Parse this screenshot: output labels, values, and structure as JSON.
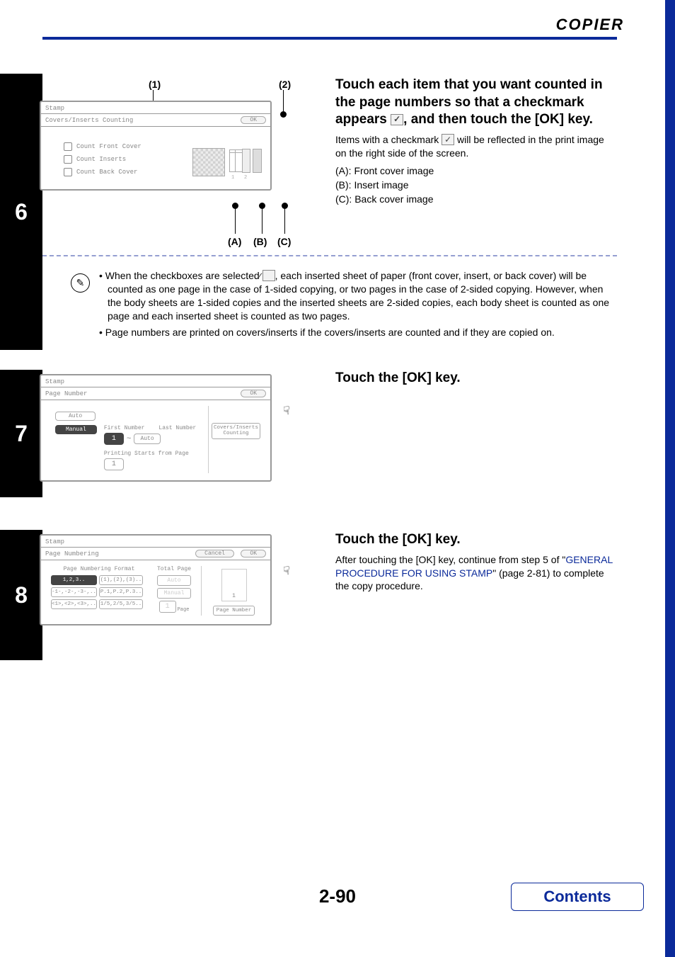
{
  "header": {
    "title": "COPIER"
  },
  "step6": {
    "num": "6",
    "heading_pre": "Touch each item that you want counted in the page numbers so that a checkmark appears ",
    "heading_post": ", and then touch the [OK] key.",
    "sub_pre": "Items with a checkmark ",
    "sub_post": " will be reflected in the print image on the right side of the screen.",
    "labels": {
      "a": "(A): Front cover image",
      "b": "(B): Insert image",
      "c": "(C): Back cover image"
    },
    "callouts": {
      "c1": "(1)",
      "c2": "(2)",
      "ca": "(A)",
      "cb": "(B)",
      "cc": "(C)"
    },
    "panel": {
      "tab": "Stamp",
      "title": "Covers/Inserts Counting",
      "ok": "OK",
      "opt_front": "Count Front Cover",
      "opt_inserts": "Count Inserts",
      "opt_back": "Count Back Cover"
    },
    "bullets": {
      "b1": "When the checkboxes are selected ",
      "b1_post": ", each inserted sheet of paper (front cover, insert, or back cover) will be counted as one page in the case of 1-sided copying, or two pages in the case of 2-sided copying. However, when the body sheets are 1-sided copies and the inserted sheets are 2-sided copies, each body sheet is counted as one page and each inserted sheet is counted as two pages.",
      "b2": "Page numbers are printed on covers/inserts if the covers/inserts are counted and if they are copied on."
    }
  },
  "step7": {
    "num": "7",
    "heading": "Touch the [OK] key.",
    "panel": {
      "tab": "Stamp",
      "title": "Page Number",
      "ok": "OK",
      "auto": "Auto",
      "manual": "Manual",
      "first_label": "First Number",
      "last_label": "Last Number",
      "first_val": "1",
      "tilde": "~",
      "auto_btn": "Auto",
      "start_label": "Printing Starts from Page",
      "start_val": "1",
      "covers": "Covers/Inserts Counting"
    }
  },
  "step8": {
    "num": "8",
    "heading": "Touch the [OK] key.",
    "sub_pre": "After touching the [OK] key, continue from step 5 of \"",
    "sub_link": "GENERAL PROCEDURE FOR USING STAMP",
    "sub_post": "\" (page 2-81) to complete the copy procedure.",
    "panel": {
      "tab": "Stamp",
      "title": "Page Numbering",
      "cancel": "Cancel",
      "ok": "OK",
      "format_label": "Page Numbering Format",
      "f1": "1,2,3..",
      "f2": "(1),(2),(3)..",
      "f3": "-1-,-2-,-3-,..",
      "f4": "P.1,P.2,P.3..",
      "f5": "<1>,<2>,<3>,..",
      "f6": "1/5,2/5,3/5..",
      "total_label": "Total Page",
      "total_auto": "Auto",
      "total_manual": "Manual",
      "page_val": "1",
      "page_unit": "Page",
      "preview_val": "1",
      "page_number_btn": "Page Number"
    }
  },
  "footer": {
    "page": "2-90",
    "contents": "Contents"
  }
}
